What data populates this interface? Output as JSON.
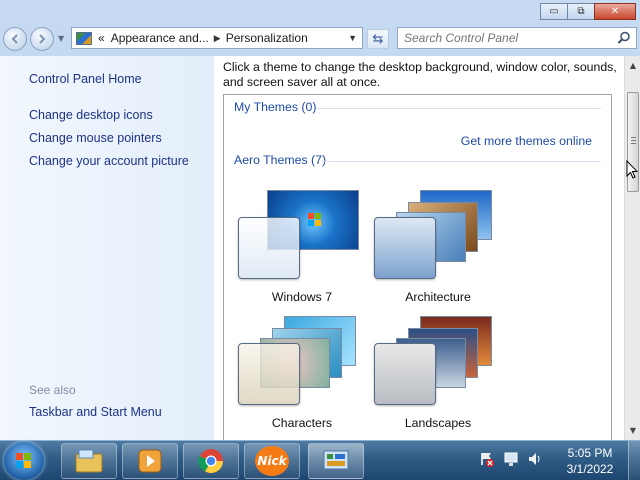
{
  "window": {
    "caption": {
      "minimize": "▭",
      "maximize": "⧉",
      "close": "✕"
    }
  },
  "navbar": {
    "back_icon": "back-arrow-icon",
    "forward_icon": "forward-arrow-icon",
    "address": {
      "overflow_chevron": "«",
      "crumbs": [
        "Appearance and...",
        "Personalization"
      ],
      "separator": "▶",
      "dropdown": "▼"
    },
    "refresh_glyph": "⇆",
    "search": {
      "placeholder": "Search Control Panel",
      "value": ""
    }
  },
  "sidebar": {
    "home": "Control Panel Home",
    "items": [
      "Change desktop icons",
      "Change mouse pointers",
      "Change your account picture"
    ],
    "see_also_header": "See also",
    "see_also_items": [
      "Taskbar and Start Menu"
    ]
  },
  "content": {
    "intro": "Click a theme to change the desktop background, window color, sounds, and screen saver all at once.",
    "my_themes_header": "My Themes (0)",
    "get_more_link": "Get more themes online",
    "aero_header": "Aero Themes (7)",
    "themes": [
      {
        "label": "Windows 7"
      },
      {
        "label": "Architecture"
      },
      {
        "label": "Characters"
      },
      {
        "label": "Landscapes"
      }
    ]
  },
  "scrollbar": {
    "up": "▲",
    "down": "▼"
  },
  "taskbar": {
    "apps": [
      "windows-explorer-icon",
      "media-player-icon",
      "chrome-icon",
      "nick-icon",
      "control-panel-icon"
    ],
    "nick_text": "Nick",
    "clock": {
      "time": "5:05 PM",
      "date": "3/1/2022"
    }
  },
  "colors": {
    "link": "#1e3287",
    "section_header": "#1e4aa8",
    "taskbar": "#2f5c85"
  }
}
